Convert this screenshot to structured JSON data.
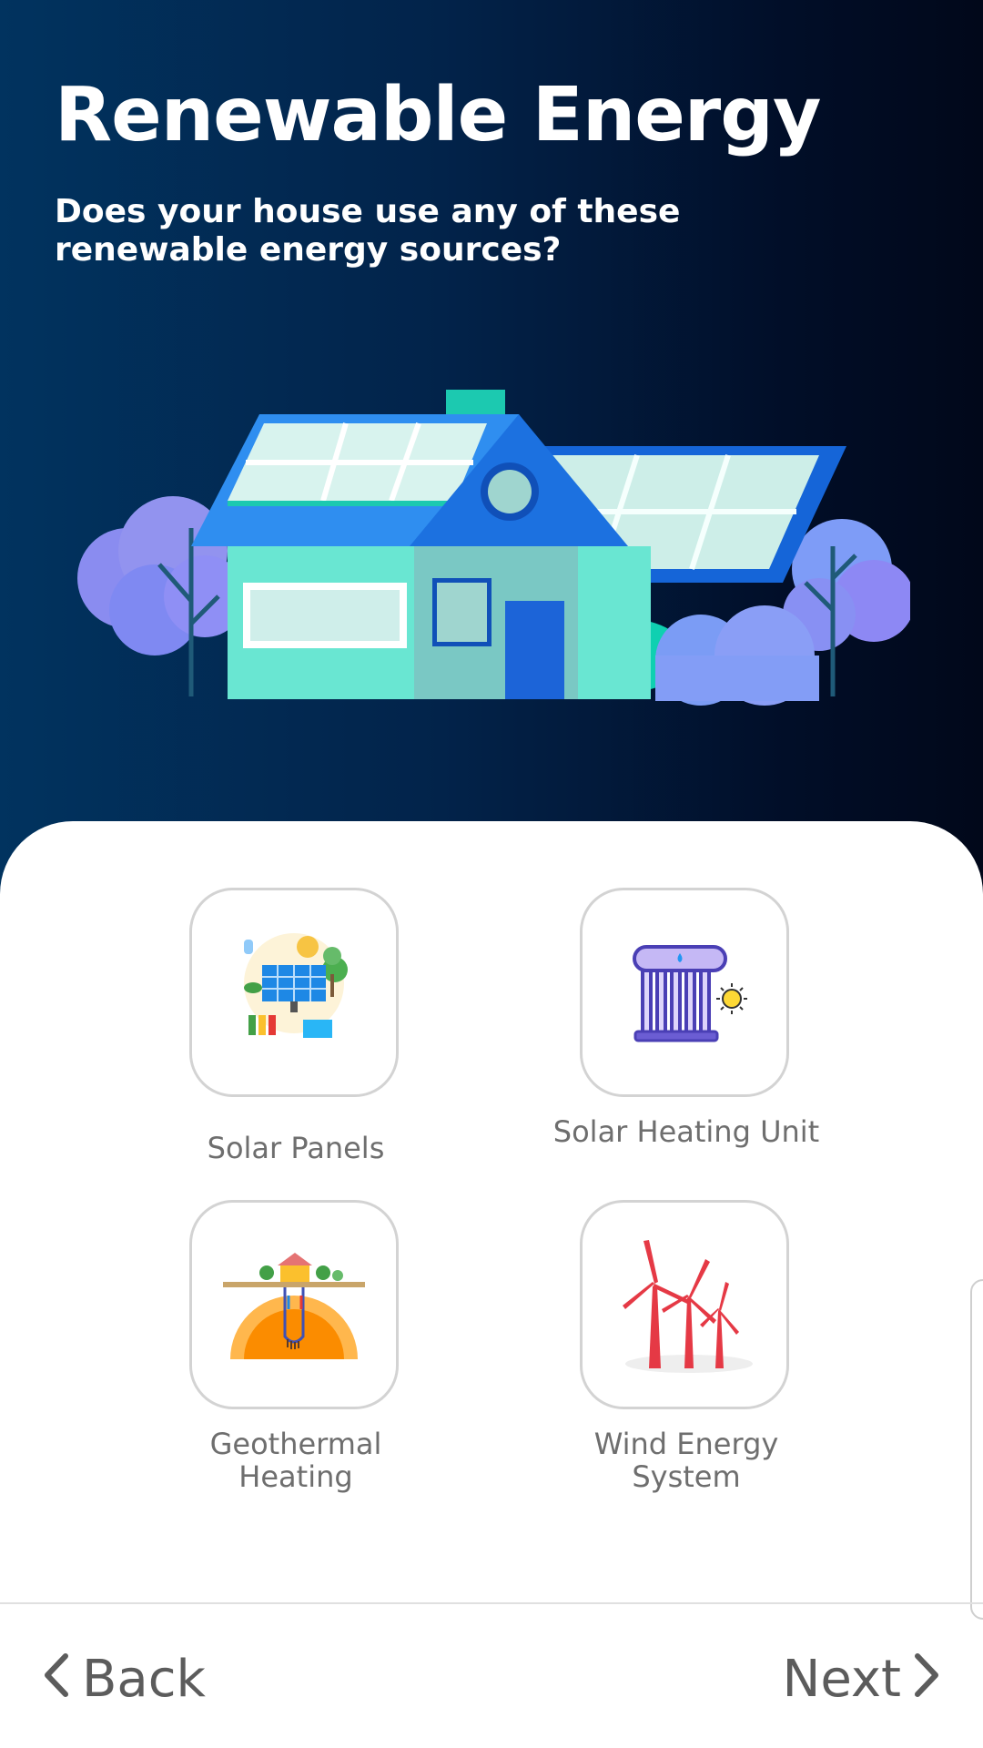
{
  "header": {
    "title": "Renewable Energy",
    "subtitle": "Does your house use any of these renewable energy sources?"
  },
  "options": [
    {
      "label": "Solar Panels",
      "icon": "solar-panels-icon"
    },
    {
      "label": "Solar Heating Unit",
      "icon": "solar-heating-icon"
    },
    {
      "label": "Geothermal Heating",
      "icon": "geothermal-icon"
    },
    {
      "label": "Wind Energy System",
      "icon": "wind-turbine-icon"
    }
  ],
  "footer": {
    "back_label": "Back",
    "next_label": "Next"
  },
  "colors": {
    "hero_gradient_start": "#01335f",
    "hero_gradient_end": "#01081a",
    "label_gray": "#6e6e6e",
    "tile_border": "#d3d3d3"
  }
}
